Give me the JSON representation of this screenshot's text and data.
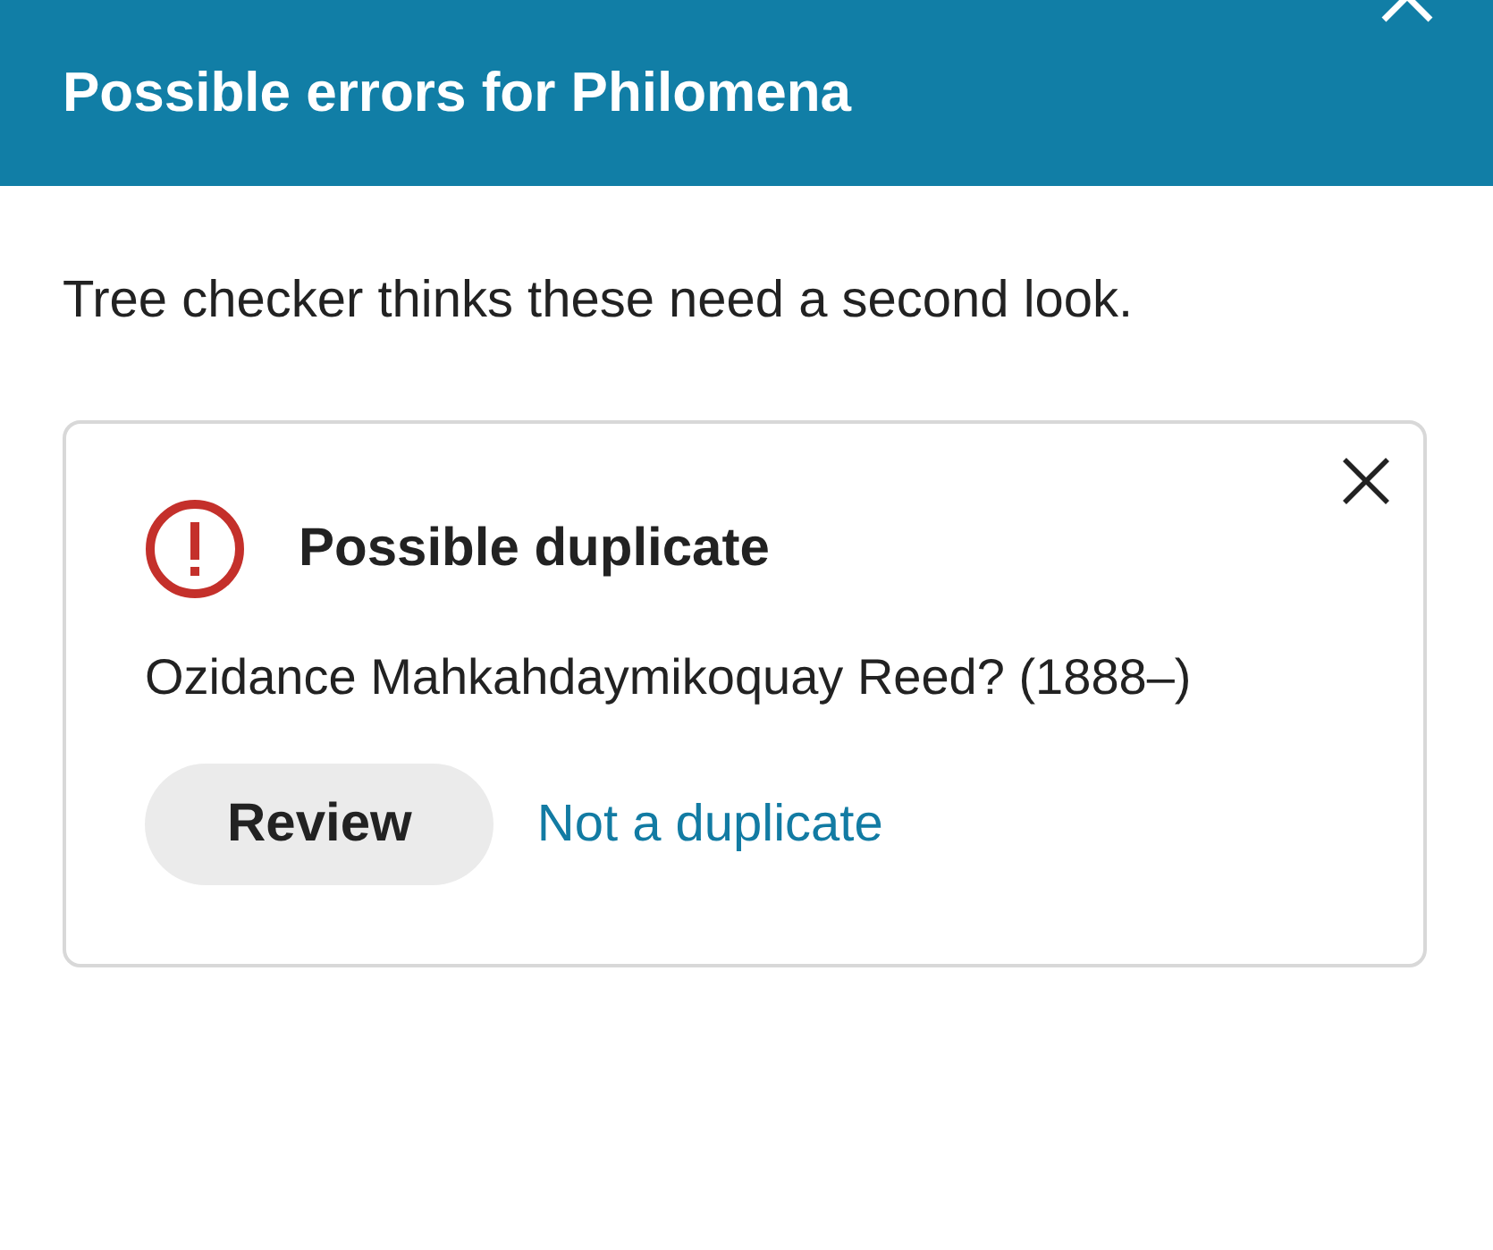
{
  "header": {
    "title": "Possible errors for Philomena"
  },
  "intro": "Tree checker thinks these need a second look.",
  "issues": [
    {
      "kind": "duplicate",
      "title": "Possible duplicate",
      "person": "Ozidance Mahkahdaymikoquay Reed? (1888–)",
      "review_button": "Review",
      "dismiss_link": "Not a duplicate"
    }
  ]
}
